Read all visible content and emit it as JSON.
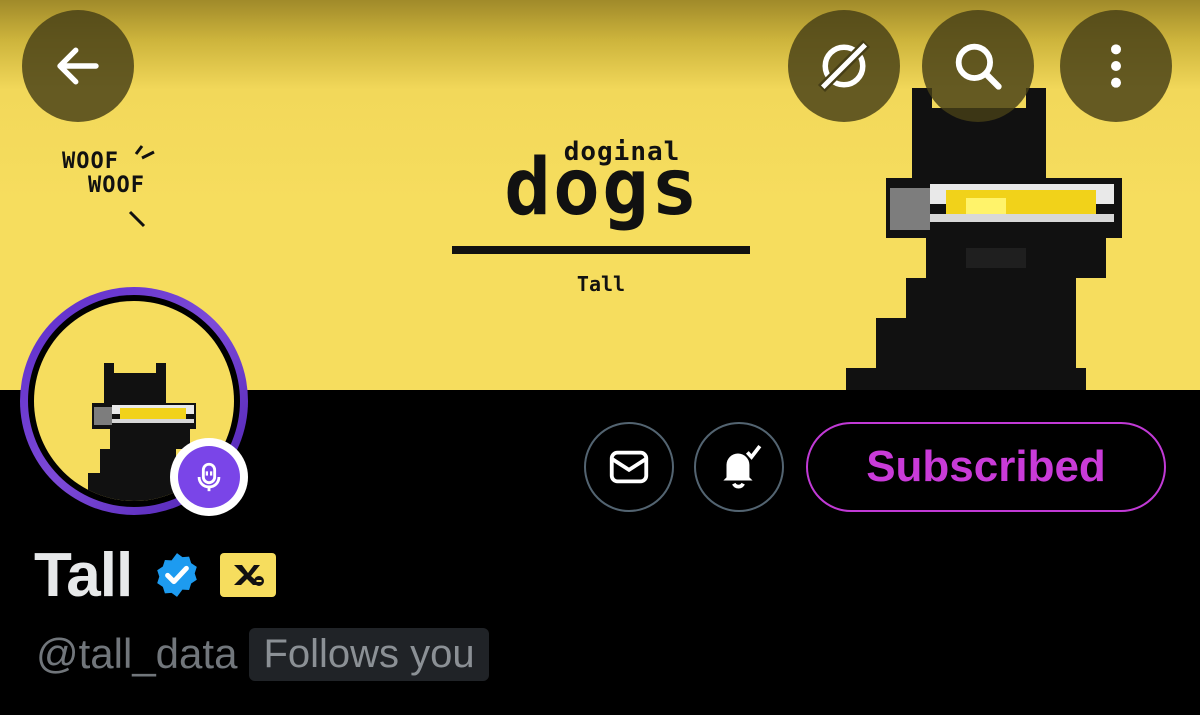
{
  "banner": {
    "woof_line1": "WOOF",
    "woof_line2": "WOOF",
    "logo_small": "doginal",
    "logo_big": "dogs",
    "logo_name": "Tall",
    "background_color": "#f6dd5e"
  },
  "header_icons": {
    "back": "arrow-left-icon",
    "grok": "grok-icon",
    "search": "search-icon",
    "more": "more-vertical-icon"
  },
  "actions": {
    "message_icon": "envelope-icon",
    "notifications_icon": "bell-check-icon",
    "subscribe_label": "Subscribed",
    "accent_color": "#c93bd8"
  },
  "profile": {
    "name": "Tall",
    "handle": "@tall_data",
    "follows_you": "Follows you",
    "verified_icon": "verified-badge-icon",
    "affiliation_icon": "affiliation-badge-icon",
    "spaces_icon": "spaces-mic-icon"
  }
}
